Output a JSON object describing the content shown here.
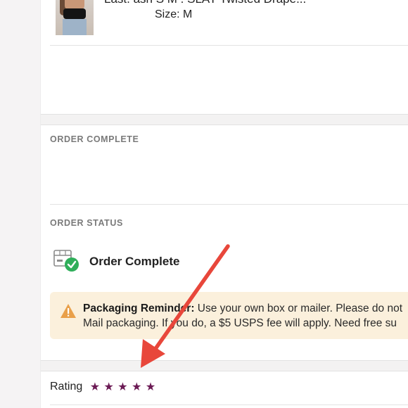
{
  "product": {
    "title_line": "Last. ash S M . SLAY Twisted Drape...",
    "size_line": "Size: M"
  },
  "sections": {
    "order_complete_label": "ORDER COMPLETE",
    "order_status_label": "ORDER STATUS"
  },
  "status": {
    "text": "Order Complete",
    "icon": "box-check-icon"
  },
  "notice": {
    "title": "Packaging Reminder:",
    "line1": " Use your own box or mailer. Please do not",
    "line2": "Mail packaging. If you do, a $5 USPS fee will apply. Need free su",
    "icon": "warning-icon"
  },
  "rating": {
    "label": "Rating",
    "stars": [
      "★",
      "★",
      "★",
      "★",
      "★"
    ],
    "star_color": "#6b1a54"
  },
  "annotation": {
    "arrow_color": "#e8473b"
  }
}
